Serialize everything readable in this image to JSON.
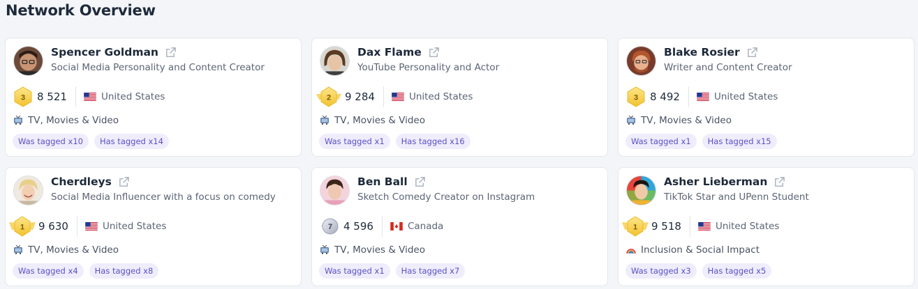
{
  "page": {
    "title": "Network Overview"
  },
  "colors": {
    "tag_bg": "#efedfc",
    "tag_text": "#5b50c4",
    "gold": "#f5c842"
  },
  "cards": [
    {
      "name": "Spencer Goldman",
      "subtitle": "Social Media Personality and Content Creator",
      "rank": "3",
      "score": "8 521",
      "country": "United States",
      "category": "TV, Movies & Video",
      "category_icon": "tv-icon",
      "tagged": "Was tagged x10",
      "has_tagged": "Has tagged x14"
    },
    {
      "name": "Dax Flame",
      "subtitle": "YouTube Personality and Actor",
      "rank": "2",
      "score": "9 284",
      "country": "United States",
      "category": "TV, Movies & Video",
      "category_icon": "tv-icon",
      "tagged": "Was tagged x1",
      "has_tagged": "Has tagged x16"
    },
    {
      "name": "Blake Rosier",
      "subtitle": "Writer and Content Creator",
      "rank": "3",
      "score": "8 492",
      "country": "United States",
      "category": "TV, Movies & Video",
      "category_icon": "tv-icon",
      "tagged": "Was tagged x1",
      "has_tagged": "Has tagged x15"
    },
    {
      "name": "Cherdleys",
      "subtitle": "Social Media Influencer with a focus on comedy",
      "rank": "1",
      "score": "9 630",
      "country": "United States",
      "category": "TV, Movies & Video",
      "category_icon": "tv-icon",
      "tagged": "Was tagged x4",
      "has_tagged": "Has tagged x8"
    },
    {
      "name": "Ben Ball",
      "subtitle": "Sketch Comedy Creator on Instagram",
      "rank": "7",
      "score": "4 596",
      "country": "Canada",
      "category": "TV, Movies & Video",
      "category_icon": "tv-icon",
      "tagged": "Was tagged x1",
      "has_tagged": "Has tagged x7"
    },
    {
      "name": "Asher Lieberman",
      "subtitle": "TikTok Star and UPenn Student",
      "rank": "1",
      "score": "9 518",
      "country": "United States",
      "category": "Inclusion & Social Impact",
      "category_icon": "rainbow-icon",
      "tagged": "Was tagged x3",
      "has_tagged": "Has tagged x5"
    }
  ]
}
